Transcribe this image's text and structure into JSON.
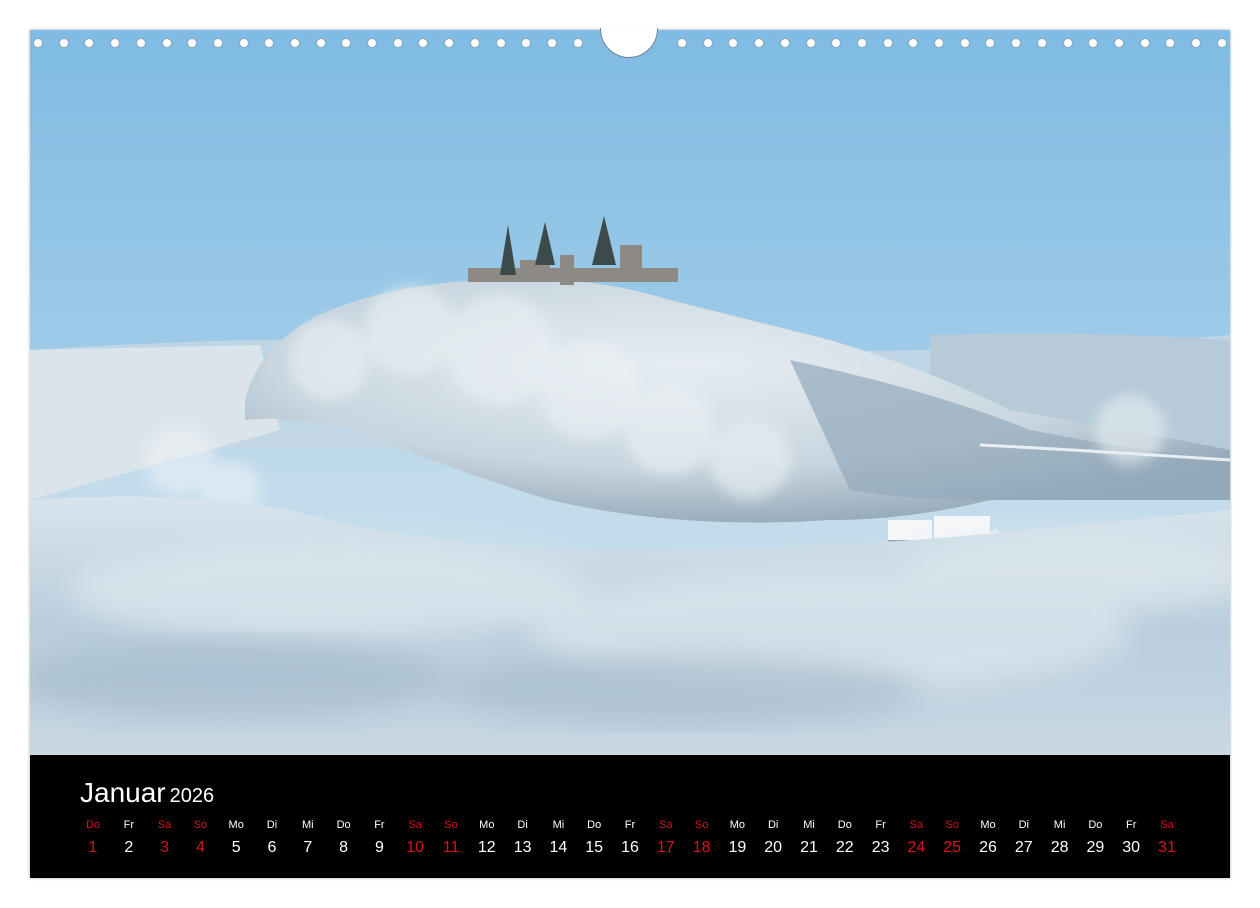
{
  "calendar": {
    "month": "Januar",
    "year": "2026",
    "weekend_color": "#d4151b",
    "days": [
      {
        "day": "1",
        "weekday": "Do",
        "weekend": true
      },
      {
        "day": "2",
        "weekday": "Fr",
        "weekend": false
      },
      {
        "day": "3",
        "weekday": "Sa",
        "weekend": true
      },
      {
        "day": "4",
        "weekday": "So",
        "weekend": true
      },
      {
        "day": "5",
        "weekday": "Mo",
        "weekend": false
      },
      {
        "day": "6",
        "weekday": "Di",
        "weekend": false
      },
      {
        "day": "7",
        "weekday": "Mi",
        "weekend": false
      },
      {
        "day": "8",
        "weekday": "Do",
        "weekend": false
      },
      {
        "day": "9",
        "weekday": "Fr",
        "weekend": false
      },
      {
        "day": "10",
        "weekday": "Sa",
        "weekend": true
      },
      {
        "day": "11",
        "weekday": "So",
        "weekend": true
      },
      {
        "day": "12",
        "weekday": "Mo",
        "weekend": false
      },
      {
        "day": "13",
        "weekday": "Di",
        "weekend": false
      },
      {
        "day": "14",
        "weekday": "Mi",
        "weekend": false
      },
      {
        "day": "15",
        "weekday": "Do",
        "weekend": false
      },
      {
        "day": "16",
        "weekday": "Fr",
        "weekend": false
      },
      {
        "day": "17",
        "weekday": "Sa",
        "weekend": true
      },
      {
        "day": "18",
        "weekday": "So",
        "weekend": true
      },
      {
        "day": "19",
        "weekday": "Mo",
        "weekend": false
      },
      {
        "day": "20",
        "weekday": "Di",
        "weekend": false
      },
      {
        "day": "21",
        "weekday": "Mi",
        "weekend": false
      },
      {
        "day": "22",
        "weekday": "Do",
        "weekend": false
      },
      {
        "day": "23",
        "weekday": "Fr",
        "weekend": false
      },
      {
        "day": "24",
        "weekday": "Sa",
        "weekend": true
      },
      {
        "day": "25",
        "weekday": "So",
        "weekend": true
      },
      {
        "day": "26",
        "weekday": "Mo",
        "weekend": false
      },
      {
        "day": "27",
        "weekday": "Di",
        "weekend": false
      },
      {
        "day": "28",
        "weekday": "Mi",
        "weekend": false
      },
      {
        "day": "29",
        "weekday": "Do",
        "weekend": false
      },
      {
        "day": "30",
        "weekday": "Fr",
        "weekend": false
      },
      {
        "day": "31",
        "weekday": "Sa",
        "weekend": true
      }
    ]
  },
  "photo": {
    "sky_color": "#8ec3e6",
    "fog_color": "#c9d8e2"
  }
}
